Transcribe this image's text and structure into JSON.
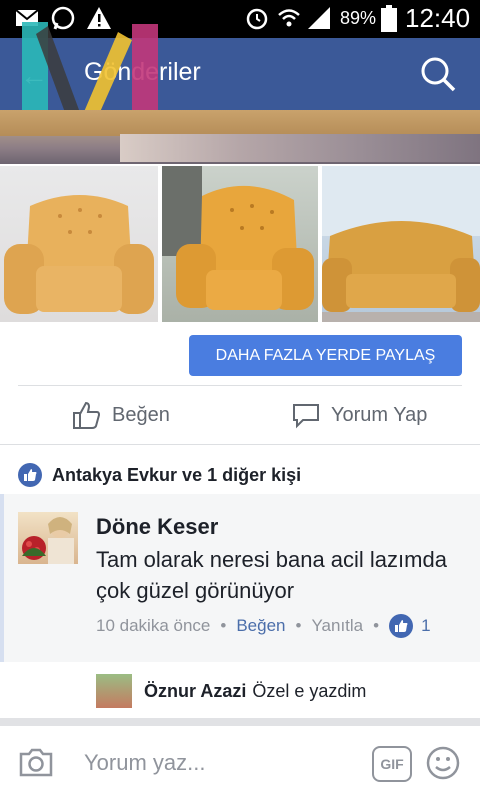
{
  "status_bar": {
    "battery": "89%",
    "time": "12:40"
  },
  "header": {
    "title": "Gönderiler"
  },
  "post": {
    "share_button": "DAHA FAZLA YERDE PAYLAŞ",
    "actions": {
      "like": "Beğen",
      "comment": "Yorum Yap"
    },
    "reactions": "Antakya Evkur ve 1 diğer kişi"
  },
  "comment": {
    "name": "Döne Keser",
    "text": "Tam olarak neresi bana acil lazımda çok güzel görünüyor",
    "time": "10 dakika önce",
    "like": "Beğen",
    "reply": "Yanıtla",
    "like_count": "1"
  },
  "reply": {
    "name": "Öznur Azazi",
    "text": "Özel e yazdim"
  },
  "composer": {
    "placeholder": "Yorum yaz...",
    "gif_label": "GIF"
  },
  "colors": {
    "header": "#3b5998",
    "accent": "#4a7de0",
    "like_blue": "#4267b2"
  }
}
